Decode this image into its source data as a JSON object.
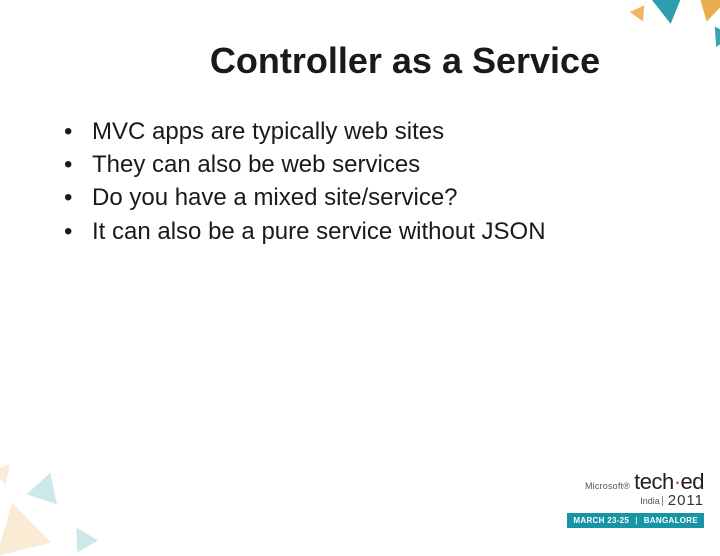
{
  "title": "Controller as a Service",
  "bullets": [
    "MVC apps are typically web sites",
    "They can also be web services",
    "Do you have a mixed site/service?",
    "It can also be a pure service without JSON"
  ],
  "footer": {
    "company": "Microsoft®",
    "brand_part1": "tech",
    "brand_part2": "ed",
    "region": "India",
    "year": "2011",
    "dates": "MARCH 23-25",
    "location": "BANGALORE"
  }
}
